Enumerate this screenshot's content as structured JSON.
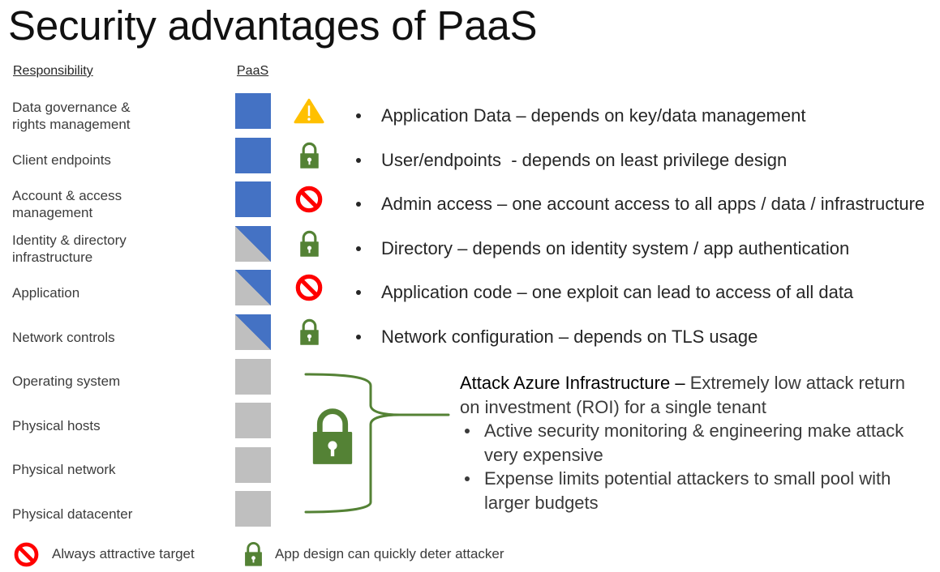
{
  "title": "Security advantages of PaaS",
  "headers": {
    "responsibility": "Responsibility",
    "service_model": "PaaS"
  },
  "rows": [
    {
      "label": [
        "Data governance &",
        "rights management"
      ],
      "fill": "blue",
      "icon": "warning-icon",
      "note": "Application Data – depends on key/data management"
    },
    {
      "label": [
        "Client endpoints"
      ],
      "fill": "blue",
      "icon": "lock-icon",
      "note": "User/endpoints  - depends on least privilege design"
    },
    {
      "label": [
        "Account & access",
        "management"
      ],
      "fill": "blue",
      "icon": "prohibited-icon",
      "note": "Admin access – one account access to all apps / data / infrastructure"
    },
    {
      "label": [
        "Identity & directory",
        "infrastructure"
      ],
      "fill": "split",
      "icon": "lock-icon",
      "note": "Directory – depends on identity system / app authentication"
    },
    {
      "label": [
        "Application"
      ],
      "fill": "split",
      "icon": "prohibited-icon",
      "note": "Application code – one exploit can lead to access of all data"
    },
    {
      "label": [
        "Network controls"
      ],
      "fill": "split",
      "icon": "lock-icon",
      "note": "Network configuration – depends on TLS usage"
    },
    {
      "label": [
        "Operating system"
      ],
      "fill": "gray"
    },
    {
      "label": [
        "Physical hosts"
      ],
      "fill": "gray"
    },
    {
      "label": [
        "Physical network"
      ],
      "fill": "gray"
    },
    {
      "label": [
        "Physical datacenter"
      ],
      "fill": "gray"
    }
  ],
  "infrastructure": {
    "icon": "lock-icon",
    "heading": "Attack Azure Infrastructure –",
    "summary": "Extremely low attack return on investment (ROI) for a single tenant",
    "bullets": [
      "Active security monitoring & engineering make attack very expensive",
      "Expense limits potential attackers to small pool with larger budgets"
    ]
  },
  "legend": [
    {
      "icon": "prohibited-icon",
      "label": "Always attractive target"
    },
    {
      "icon": "lock-icon",
      "label": "App design can quickly deter attacker"
    }
  ],
  "colors": {
    "customer_blue": "#4472C4",
    "provider_gray": "#BFBFBF",
    "lock_green": "#548235",
    "prohibited_red": "#FF0000",
    "warning_amber": "#FFC000"
  }
}
